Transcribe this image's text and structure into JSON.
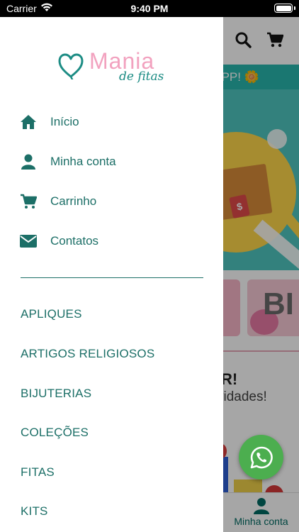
{
  "status_bar": {
    "carrier": "Carrier",
    "time": "9:40 PM"
  },
  "background": {
    "banner_text": "o APP! 🌼",
    "promo_title": "R!",
    "promo_subtitle": "vidades!",
    "bottom_nav_label": "Minha conta",
    "category_card_text": "BI",
    "hero_tag": "$"
  },
  "drawer": {
    "logo": {
      "brand": "Mania",
      "tagline": "de fitas"
    },
    "menu": [
      {
        "label": "Início",
        "icon": "home-icon"
      },
      {
        "label": "Minha conta",
        "icon": "user-icon"
      },
      {
        "label": "Carrinho",
        "icon": "cart-icon"
      },
      {
        "label": "Contatos",
        "icon": "envelope-icon"
      }
    ],
    "categories": [
      "APLIQUES",
      "ARTIGOS RELIGIOSOS",
      "BIJUTERIAS",
      "COLEÇÕES",
      "FITAS",
      "KITS"
    ]
  },
  "colors": {
    "primary": "#1c6f67",
    "brand_pink": "#f2a2bf",
    "whatsapp": "#4cae4f"
  }
}
